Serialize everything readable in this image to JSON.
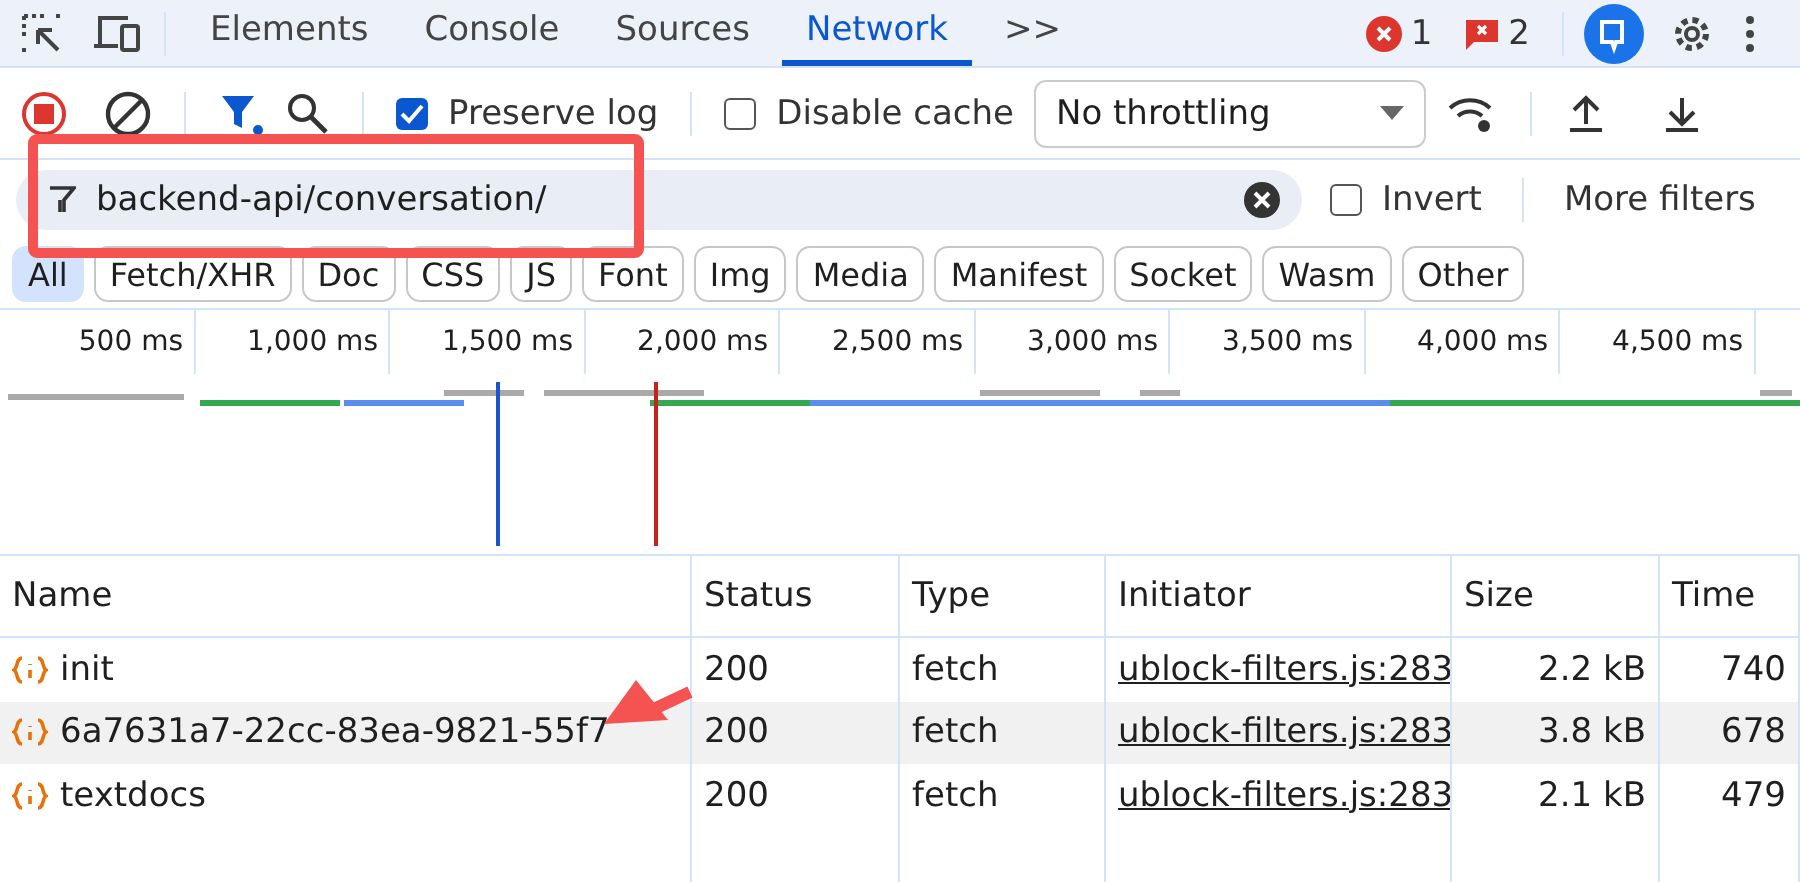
{
  "tabs": [
    {
      "label": "Elements",
      "selected": false
    },
    {
      "label": "Console",
      "selected": false
    },
    {
      "label": "Sources",
      "selected": false
    },
    {
      "label": "Network",
      "selected": true
    }
  ],
  "more_tabs": ">>",
  "counters": [
    {
      "kind": "error",
      "count": "1"
    },
    {
      "kind": "issue",
      "count": "2"
    }
  ],
  "toolbar": {
    "preserve_log": {
      "label": "Preserve log",
      "checked": true
    },
    "disable_cache": {
      "label": "Disable cache",
      "checked": false
    },
    "throttling": "No throttling"
  },
  "filter": {
    "value": "backend-api/conversation/",
    "invert": {
      "label": "Invert",
      "checked": false
    },
    "more_filters": "More filters"
  },
  "type_filters": [
    {
      "label": "All",
      "selected": true
    },
    {
      "label": "Fetch/XHR",
      "selected": false
    },
    {
      "label": "Doc",
      "selected": false
    },
    {
      "label": "CSS",
      "selected": false
    },
    {
      "label": "JS",
      "selected": false
    },
    {
      "label": "Font",
      "selected": false
    },
    {
      "label": "Img",
      "selected": false
    },
    {
      "label": "Media",
      "selected": false
    },
    {
      "label": "Manifest",
      "selected": false
    },
    {
      "label": "Socket",
      "selected": false
    },
    {
      "label": "Wasm",
      "selected": false
    },
    {
      "label": "Other",
      "selected": false
    }
  ],
  "timeline_ticks": [
    "500 ms",
    "1,000 ms",
    "1,500 ms",
    "2,000 ms",
    "2,500 ms",
    "3,000 ms",
    "3,500 ms",
    "4,000 ms",
    "4,500 ms"
  ],
  "table": {
    "columns": [
      "Name",
      "Status",
      "Type",
      "Initiator",
      "Size",
      "Time"
    ],
    "rows": [
      {
        "name": "init",
        "status": "200",
        "type": "fetch",
        "initiator": "ublock-filters.js:283",
        "size": "2.2 kB",
        "time": "740",
        "selected": false
      },
      {
        "name": "6a7631a7-22cc-83ea-9821-55f7",
        "status": "200",
        "type": "fetch",
        "initiator": "ublock-filters.js:283",
        "size": "3.8 kB",
        "time": "678",
        "selected": true
      },
      {
        "name": "textdocs",
        "status": "200",
        "type": "fetch",
        "initiator": "ublock-filters.js:283",
        "size": "2.1 kB",
        "time": "479",
        "selected": false
      }
    ]
  }
}
